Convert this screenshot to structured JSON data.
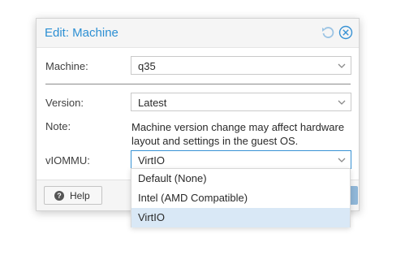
{
  "dialog": {
    "title": "Edit: Machine",
    "header_icons": [
      "reset-icon",
      "close-icon"
    ]
  },
  "form": {
    "machine": {
      "label": "Machine:",
      "value": "q35"
    },
    "version": {
      "label": "Version:",
      "value": "Latest"
    },
    "note": {
      "label": "Note:",
      "text": "Machine version change may affect hardware layout and settings in the guest OS."
    },
    "viommu": {
      "label": "vIOMMU:",
      "value": "VirtIO"
    }
  },
  "footer": {
    "help_label": "Help"
  },
  "dropdown": {
    "options": [
      "Default (None)",
      "Intel (AMD Compatible)",
      "VirtIO"
    ],
    "selected": "VirtIO"
  },
  "colors": {
    "title": "#2c8fd3",
    "focus_border": "#3892d4",
    "selected_option_bg": "#d9e8f6"
  }
}
